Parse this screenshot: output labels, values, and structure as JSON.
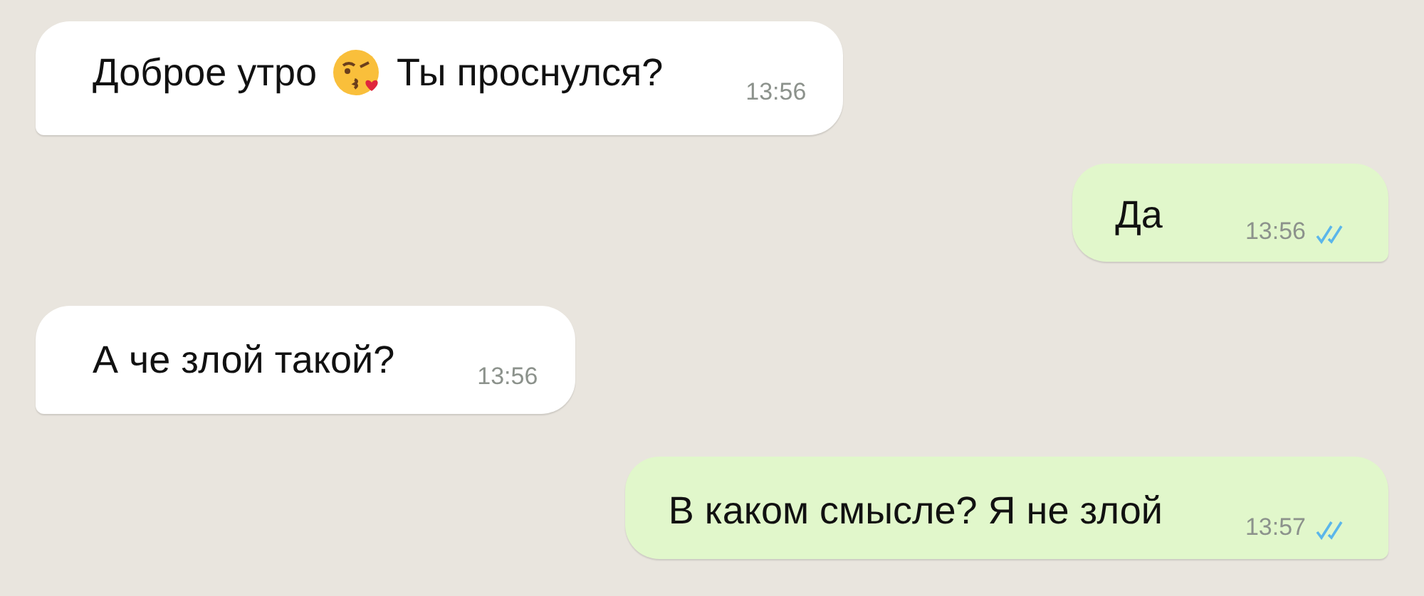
{
  "messages": [
    {
      "kind": "incoming",
      "parts": [
        {
          "kind": "text",
          "text": "Доброе утро"
        },
        {
          "kind": "emoji"
        },
        {
          "kind": "text",
          "text": "Ты проснулся?"
        }
      ],
      "time": "13:56"
    },
    {
      "kind": "outgoing",
      "parts": [
        {
          "kind": "text",
          "text": "Да"
        }
      ],
      "time": "13:56",
      "read": true
    },
    {
      "kind": "incoming",
      "parts": [
        {
          "kind": "text",
          "text": "А че злой такой?"
        }
      ],
      "time": "13:56"
    },
    {
      "kind": "outgoing",
      "parts": [
        {
          "kind": "text",
          "text": "В каком смысле? Я не злой"
        }
      ],
      "time": "13:57",
      "read": true
    }
  ]
}
